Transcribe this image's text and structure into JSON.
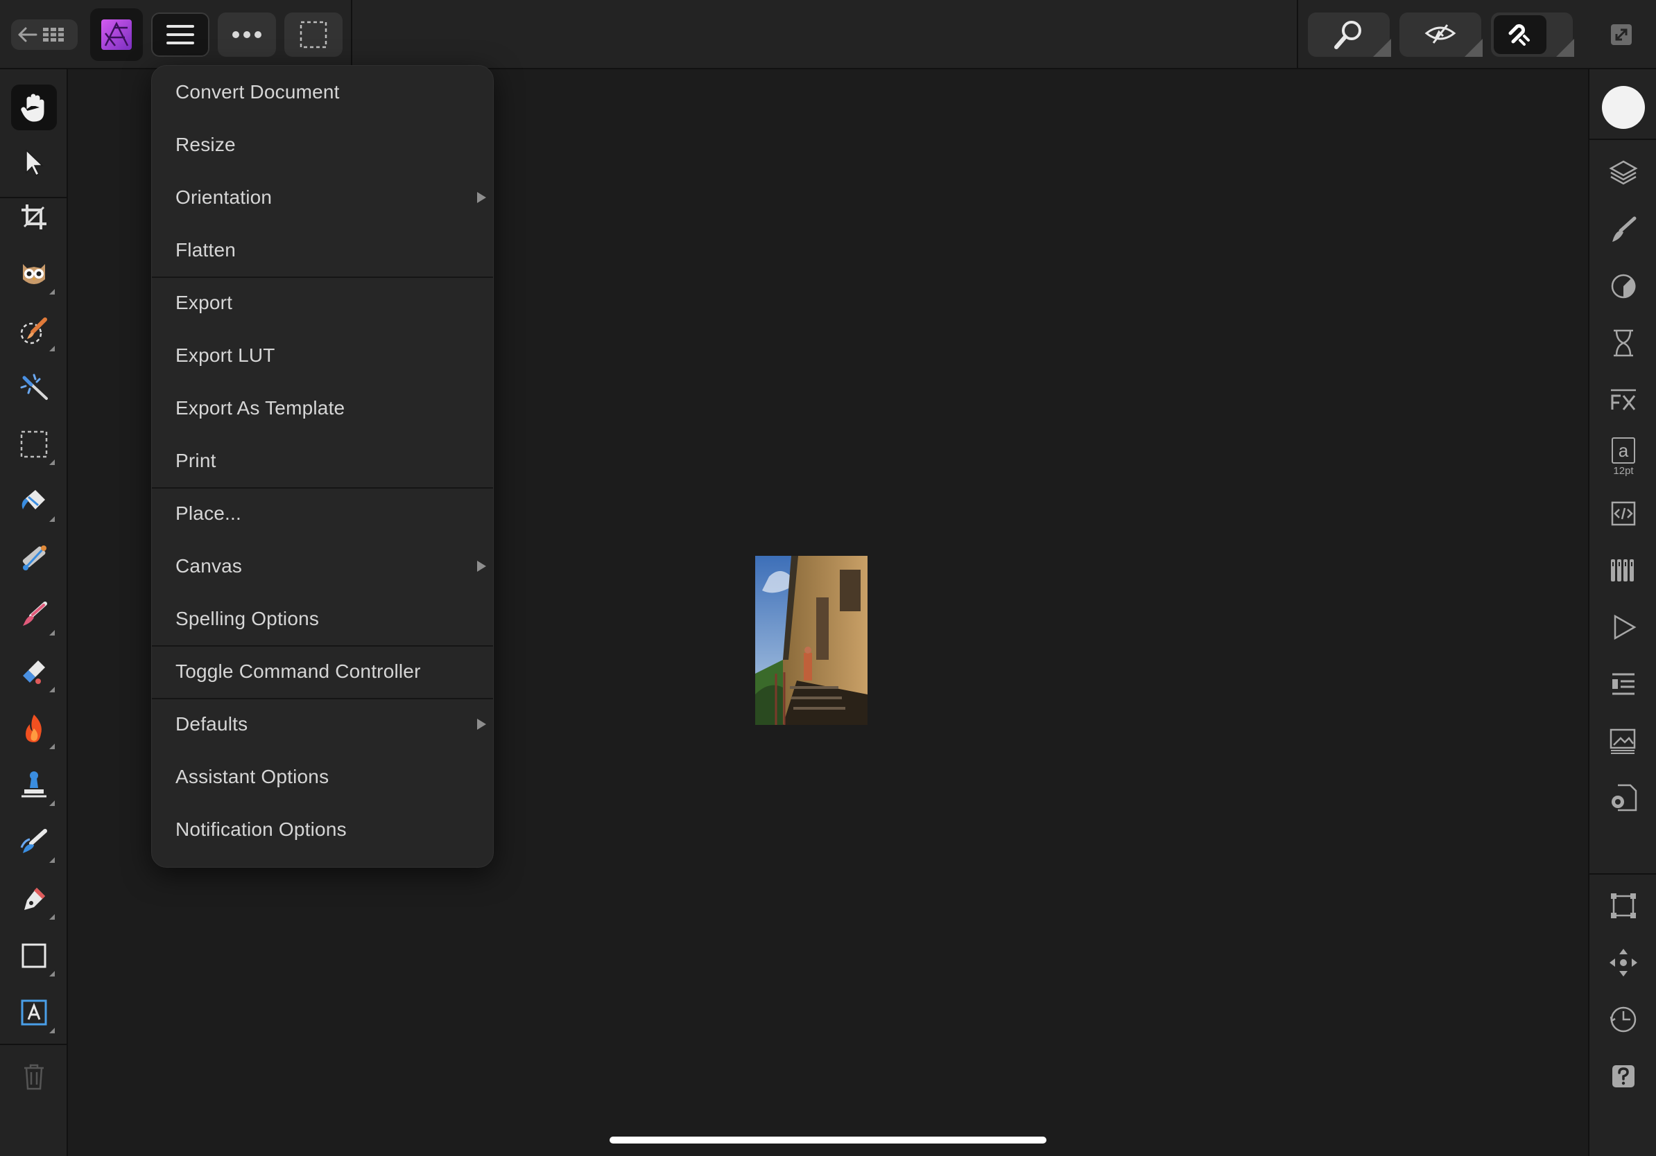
{
  "app": {
    "name": "Affinity Photo",
    "accent": "#b44bdc"
  },
  "topbar": {
    "back_icon": "back-grid-icon",
    "menu_icon": "hamburger-menu-icon",
    "more_icon": "more-dots-icon",
    "selection_icon": "marquee-selection-icon",
    "zoom_icon": "zoom-icon",
    "view_icon": "view-mode-icon",
    "snap_icon": "snapping-magnet-icon",
    "fullscreen_icon": "fullscreen-icon"
  },
  "menu": {
    "items": [
      {
        "label": "Convert Document",
        "submenu": false
      },
      {
        "label": "Resize",
        "submenu": false
      },
      {
        "label": "Orientation",
        "submenu": true
      },
      {
        "label": "Flatten",
        "submenu": false
      },
      {
        "label": "Export",
        "submenu": false
      },
      {
        "label": "Export LUT",
        "submenu": false
      },
      {
        "label": "Export As Template",
        "submenu": false
      },
      {
        "label": "Print",
        "submenu": false
      },
      {
        "label": "Place...",
        "submenu": false
      },
      {
        "label": "Canvas",
        "submenu": true
      },
      {
        "label": "Spelling Options",
        "submenu": false
      },
      {
        "label": "Toggle Command Controller",
        "submenu": false
      },
      {
        "label": "Defaults",
        "submenu": true
      },
      {
        "label": "Assistant Options",
        "submenu": false
      },
      {
        "label": "Notification Options",
        "submenu": false
      }
    ]
  },
  "rightbar": {
    "text_size_letter": "a",
    "text_size_value": "12pt"
  }
}
